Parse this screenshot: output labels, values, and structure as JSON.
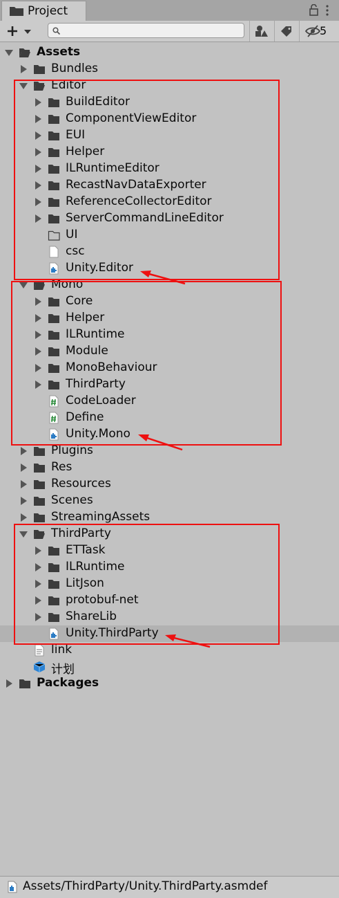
{
  "window": {
    "tab_title": "Project",
    "hidden_count": "5"
  },
  "search": {
    "placeholder": ""
  },
  "tree": [
    {
      "label": "Assets",
      "depth": 0,
      "state": "open",
      "kind": "folder",
      "bold": true
    },
    {
      "label": "Bundles",
      "depth": 1,
      "state": "closed",
      "kind": "folder"
    },
    {
      "label": "Editor",
      "depth": 1,
      "state": "open",
      "kind": "folder"
    },
    {
      "label": "BuildEditor",
      "depth": 2,
      "state": "closed",
      "kind": "folder"
    },
    {
      "label": "ComponentViewEditor",
      "depth": 2,
      "state": "closed",
      "kind": "folder"
    },
    {
      "label": "EUI",
      "depth": 2,
      "state": "closed",
      "kind": "folder"
    },
    {
      "label": "Helper",
      "depth": 2,
      "state": "closed",
      "kind": "folder"
    },
    {
      "label": "ILRuntimeEditor",
      "depth": 2,
      "state": "closed",
      "kind": "folder"
    },
    {
      "label": "RecastNavDataExporter",
      "depth": 2,
      "state": "closed",
      "kind": "folder"
    },
    {
      "label": "ReferenceCollectorEditor",
      "depth": 2,
      "state": "closed",
      "kind": "folder"
    },
    {
      "label": "ServerCommandLineEditor",
      "depth": 2,
      "state": "closed",
      "kind": "folder"
    },
    {
      "label": "UI",
      "depth": 2,
      "state": "none",
      "kind": "empty-folder"
    },
    {
      "label": "csc",
      "depth": 2,
      "state": "none",
      "kind": "file"
    },
    {
      "label": "Unity.Editor",
      "depth": 2,
      "state": "none",
      "kind": "asmdef"
    },
    {
      "label": "Mono",
      "depth": 1,
      "state": "open",
      "kind": "folder"
    },
    {
      "label": "Core",
      "depth": 2,
      "state": "closed",
      "kind": "folder"
    },
    {
      "label": "Helper",
      "depth": 2,
      "state": "closed",
      "kind": "folder"
    },
    {
      "label": "ILRuntime",
      "depth": 2,
      "state": "closed",
      "kind": "folder"
    },
    {
      "label": "Module",
      "depth": 2,
      "state": "closed",
      "kind": "folder"
    },
    {
      "label": "MonoBehaviour",
      "depth": 2,
      "state": "closed",
      "kind": "folder"
    },
    {
      "label": "ThirdParty",
      "depth": 2,
      "state": "closed",
      "kind": "folder"
    },
    {
      "label": "CodeLoader",
      "depth": 2,
      "state": "none",
      "kind": "script"
    },
    {
      "label": "Define",
      "depth": 2,
      "state": "none",
      "kind": "script"
    },
    {
      "label": "Unity.Mono",
      "depth": 2,
      "state": "none",
      "kind": "asmdef"
    },
    {
      "label": "Plugins",
      "depth": 1,
      "state": "closed",
      "kind": "folder"
    },
    {
      "label": "Res",
      "depth": 1,
      "state": "closed",
      "kind": "folder"
    },
    {
      "label": "Resources",
      "depth": 1,
      "state": "closed",
      "kind": "folder"
    },
    {
      "label": "Scenes",
      "depth": 1,
      "state": "closed",
      "kind": "folder"
    },
    {
      "label": "StreamingAssets",
      "depth": 1,
      "state": "closed",
      "kind": "folder"
    },
    {
      "label": "ThirdParty",
      "depth": 1,
      "state": "open",
      "kind": "folder"
    },
    {
      "label": "ETTask",
      "depth": 2,
      "state": "closed",
      "kind": "folder"
    },
    {
      "label": "ILRuntime",
      "depth": 2,
      "state": "closed",
      "kind": "folder"
    },
    {
      "label": "LitJson",
      "depth": 2,
      "state": "closed",
      "kind": "folder"
    },
    {
      "label": "protobuf-net",
      "depth": 2,
      "state": "closed",
      "kind": "folder"
    },
    {
      "label": "ShareLib",
      "depth": 2,
      "state": "closed",
      "kind": "folder"
    },
    {
      "label": "Unity.ThirdParty",
      "depth": 2,
      "state": "none",
      "kind": "asmdef",
      "selected": true
    },
    {
      "label": "link",
      "depth": 1,
      "state": "none",
      "kind": "text-file"
    },
    {
      "label": "计划",
      "depth": 1,
      "state": "none",
      "kind": "prefab"
    },
    {
      "label": "Packages",
      "depth": 0,
      "state": "closed",
      "kind": "folder",
      "bold": true
    }
  ],
  "status": {
    "path": "Assets/ThirdParty/Unity.ThirdParty.asmdef"
  },
  "colors": {
    "annotation": "#ee1010",
    "selection": "#b2b2b2",
    "background": "#c2c2c2"
  }
}
